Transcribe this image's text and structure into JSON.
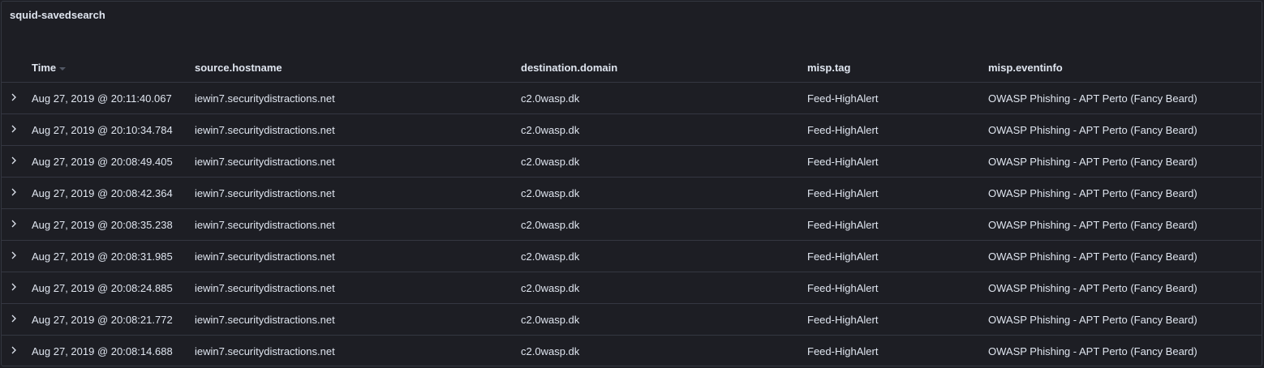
{
  "panel": {
    "title": "squid-savedsearch"
  },
  "table": {
    "columns": {
      "time": "Time",
      "source_hostname": "source.hostname",
      "destination_domain": "destination.domain",
      "misp_tag": "misp.tag",
      "misp_eventinfo": "misp.eventinfo"
    },
    "rows": [
      {
        "time": "Aug 27, 2019 @ 20:11:40.067",
        "source_hostname": "iewin7.securitydistractions.net",
        "destination_domain": "c2.0wasp.dk",
        "misp_tag": "Feed-HighAlert",
        "misp_eventinfo": "OWASP Phishing - APT Perto (Fancy Beard)"
      },
      {
        "time": "Aug 27, 2019 @ 20:10:34.784",
        "source_hostname": "iewin7.securitydistractions.net",
        "destination_domain": "c2.0wasp.dk",
        "misp_tag": "Feed-HighAlert",
        "misp_eventinfo": "OWASP Phishing - APT Perto (Fancy Beard)"
      },
      {
        "time": "Aug 27, 2019 @ 20:08:49.405",
        "source_hostname": "iewin7.securitydistractions.net",
        "destination_domain": "c2.0wasp.dk",
        "misp_tag": "Feed-HighAlert",
        "misp_eventinfo": "OWASP Phishing - APT Perto (Fancy Beard)"
      },
      {
        "time": "Aug 27, 2019 @ 20:08:42.364",
        "source_hostname": "iewin7.securitydistractions.net",
        "destination_domain": "c2.0wasp.dk",
        "misp_tag": "Feed-HighAlert",
        "misp_eventinfo": "OWASP Phishing - APT Perto (Fancy Beard)"
      },
      {
        "time": "Aug 27, 2019 @ 20:08:35.238",
        "source_hostname": "iewin7.securitydistractions.net",
        "destination_domain": "c2.0wasp.dk",
        "misp_tag": "Feed-HighAlert",
        "misp_eventinfo": "OWASP Phishing - APT Perto (Fancy Beard)"
      },
      {
        "time": "Aug 27, 2019 @ 20:08:31.985",
        "source_hostname": "iewin7.securitydistractions.net",
        "destination_domain": "c2.0wasp.dk",
        "misp_tag": "Feed-HighAlert",
        "misp_eventinfo": "OWASP Phishing - APT Perto (Fancy Beard)"
      },
      {
        "time": "Aug 27, 2019 @ 20:08:24.885",
        "source_hostname": "iewin7.securitydistractions.net",
        "destination_domain": "c2.0wasp.dk",
        "misp_tag": "Feed-HighAlert",
        "misp_eventinfo": "OWASP Phishing - APT Perto (Fancy Beard)"
      },
      {
        "time": "Aug 27, 2019 @ 20:08:21.772",
        "source_hostname": "iewin7.securitydistractions.net",
        "destination_domain": "c2.0wasp.dk",
        "misp_tag": "Feed-HighAlert",
        "misp_eventinfo": "OWASP Phishing - APT Perto (Fancy Beard)"
      },
      {
        "time": "Aug 27, 2019 @ 20:08:14.688",
        "source_hostname": "iewin7.securitydistractions.net",
        "destination_domain": "c2.0wasp.dk",
        "misp_tag": "Feed-HighAlert",
        "misp_eventinfo": "OWASP Phishing - APT Perto (Fancy Beard)"
      }
    ]
  },
  "icons": {
    "expand": "chevron-right-icon",
    "sort": "sort-down-icon"
  },
  "colors": {
    "background": "#1d1e24",
    "border": "#343741",
    "text": "#dfe5ef"
  }
}
